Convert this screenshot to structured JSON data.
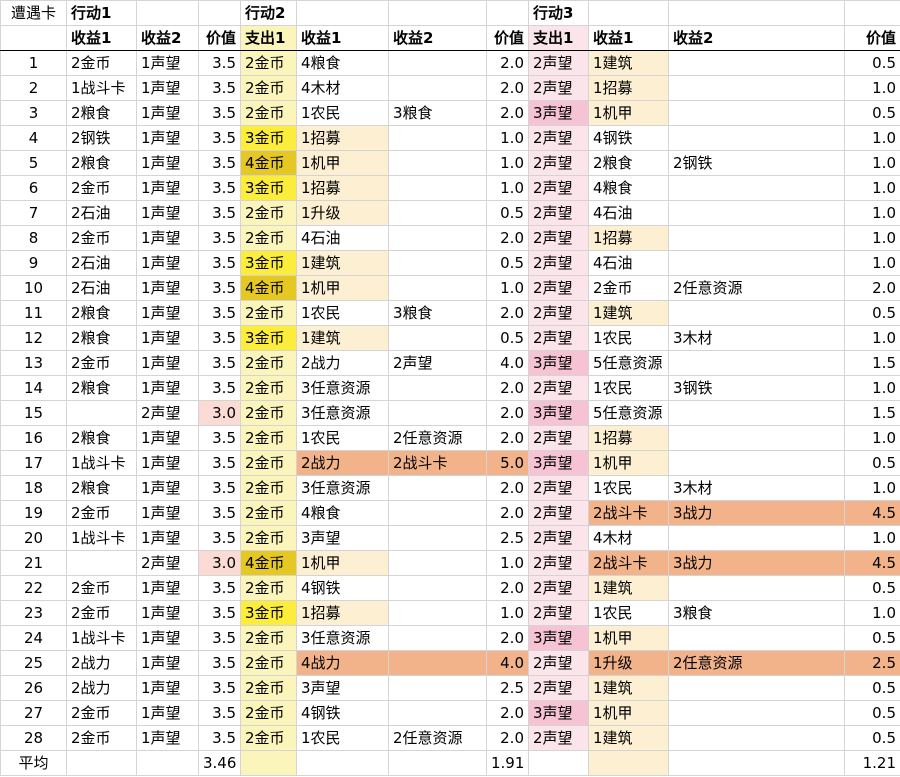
{
  "headers": {
    "row1": [
      "遭遇卡",
      "行动1",
      "",
      "",
      "行动2",
      "",
      "",
      "",
      "行动3",
      "",
      "",
      ""
    ],
    "row2": [
      "",
      "收益1",
      "收益2",
      "价值",
      "支出1",
      "收益1",
      "收益2",
      "价值",
      "支出1",
      "收益1",
      "收益2",
      "价值"
    ]
  },
  "rows": [
    [
      "1",
      "2金币",
      "1声望",
      "3.5",
      "2金币",
      "4粮食",
      "",
      "2.0",
      "2声望",
      "1建筑",
      "",
      "0.5"
    ],
    [
      "2",
      "1战斗卡",
      "1声望",
      "3.5",
      "2金币",
      "4木材",
      "",
      "2.0",
      "2声望",
      "1招募",
      "",
      "1.0"
    ],
    [
      "3",
      "2粮食",
      "1声望",
      "3.5",
      "2金币",
      "1农民",
      "3粮食",
      "2.0",
      "3声望",
      "1机甲",
      "",
      "0.5"
    ],
    [
      "4",
      "2钢铁",
      "1声望",
      "3.5",
      "3金币",
      "1招募",
      "",
      "1.0",
      "2声望",
      "4钢铁",
      "",
      "1.0"
    ],
    [
      "5",
      "2粮食",
      "1声望",
      "3.5",
      "4金币",
      "1机甲",
      "",
      "1.0",
      "2声望",
      "2粮食",
      "2钢铁",
      "1.0"
    ],
    [
      "6",
      "2金币",
      "1声望",
      "3.5",
      "3金币",
      "1招募",
      "",
      "1.0",
      "2声望",
      "4粮食",
      "",
      "1.0"
    ],
    [
      "7",
      "2石油",
      "1声望",
      "3.5",
      "2金币",
      "1升级",
      "",
      "0.5",
      "2声望",
      "4石油",
      "",
      "1.0"
    ],
    [
      "8",
      "2金币",
      "1声望",
      "3.5",
      "2金币",
      "4石油",
      "",
      "2.0",
      "2声望",
      "1招募",
      "",
      "1.0"
    ],
    [
      "9",
      "2石油",
      "1声望",
      "3.5",
      "3金币",
      "1建筑",
      "",
      "0.5",
      "2声望",
      "4石油",
      "",
      "1.0"
    ],
    [
      "10",
      "2石油",
      "1声望",
      "3.5",
      "4金币",
      "1机甲",
      "",
      "1.0",
      "2声望",
      "2金币",
      "2任意资源",
      "2.0"
    ],
    [
      "11",
      "2粮食",
      "1声望",
      "3.5",
      "2金币",
      "1农民",
      "3粮食",
      "2.0",
      "2声望",
      "1建筑",
      "",
      "0.5"
    ],
    [
      "12",
      "2粮食",
      "1声望",
      "3.5",
      "3金币",
      "1建筑",
      "",
      "0.5",
      "2声望",
      "1农民",
      "3木材",
      "1.0"
    ],
    [
      "13",
      "2金币",
      "1声望",
      "3.5",
      "2金币",
      "2战力",
      "2声望",
      "4.0",
      "3声望",
      "5任意资源",
      "",
      "1.5"
    ],
    [
      "14",
      "2粮食",
      "1声望",
      "3.5",
      "2金币",
      "3任意资源",
      "",
      "2.0",
      "2声望",
      "1农民",
      "3钢铁",
      "1.0"
    ],
    [
      "15",
      "",
      "2声望",
      "3.0",
      "2金币",
      "3任意资源",
      "",
      "2.0",
      "3声望",
      "5任意资源",
      "",
      "1.5"
    ],
    [
      "16",
      "2粮食",
      "1声望",
      "3.5",
      "2金币",
      "1农民",
      "2任意资源",
      "2.0",
      "2声望",
      "1招募",
      "",
      "1.0"
    ],
    [
      "17",
      "1战斗卡",
      "1声望",
      "3.5",
      "2金币",
      "2战力",
      "2战斗卡",
      "5.0",
      "3声望",
      "1机甲",
      "",
      "0.5"
    ],
    [
      "18",
      "2粮食",
      "1声望",
      "3.5",
      "2金币",
      "3任意资源",
      "",
      "2.0",
      "2声望",
      "1农民",
      "3木材",
      "1.0"
    ],
    [
      "19",
      "2金币",
      "1声望",
      "3.5",
      "2金币",
      "4粮食",
      "",
      "2.0",
      "2声望",
      "2战斗卡",
      "3战力",
      "4.5"
    ],
    [
      "20",
      "1战斗卡",
      "1声望",
      "3.5",
      "2金币",
      "3声望",
      "",
      "2.5",
      "2声望",
      "4木材",
      "",
      "1.0"
    ],
    [
      "21",
      "",
      "2声望",
      "3.0",
      "4金币",
      "1机甲",
      "",
      "1.0",
      "2声望",
      "2战斗卡",
      "3战力",
      "4.5"
    ],
    [
      "22",
      "2金币",
      "1声望",
      "3.5",
      "2金币",
      "4钢铁",
      "",
      "2.0",
      "2声望",
      "1建筑",
      "",
      "0.5"
    ],
    [
      "23",
      "2金币",
      "1声望",
      "3.5",
      "3金币",
      "1招募",
      "",
      "1.0",
      "2声望",
      "1农民",
      "3粮食",
      "1.0"
    ],
    [
      "24",
      "1战斗卡",
      "1声望",
      "3.5",
      "2金币",
      "3任意资源",
      "",
      "2.0",
      "3声望",
      "1机甲",
      "",
      "0.5"
    ],
    [
      "25",
      "2战力",
      "1声望",
      "3.5",
      "2金币",
      "4战力",
      "",
      "4.0",
      "2声望",
      "1升级",
      "2任意资源",
      "2.5"
    ],
    [
      "26",
      "2战力",
      "1声望",
      "3.5",
      "2金币",
      "3声望",
      "",
      "2.5",
      "2声望",
      "1建筑",
      "",
      "0.5"
    ],
    [
      "27",
      "2金币",
      "1声望",
      "3.5",
      "2金币",
      "4钢铁",
      "",
      "2.0",
      "3声望",
      "1机甲",
      "",
      "0.5"
    ],
    [
      "28",
      "2金币",
      "1声望",
      "3.5",
      "2金币",
      "1农民",
      "2任意资源",
      "2.0",
      "2声望",
      "1建筑",
      "",
      "0.5"
    ]
  ],
  "average": [
    "平均",
    "",
    "",
    "3.46",
    "",
    "",
    "",
    "1.91",
    "",
    "",
    "",
    "1.21"
  ],
  "colors": {
    "light_yellow": "#fbf5bb",
    "light_pink": "#fbe5ea",
    "cream": "#fdf0d2",
    "yellow": "#fcec3c",
    "dark_yellow": "#e6c825",
    "pink": "#f5c3d3",
    "orange": "#f2b38b",
    "salmon": "#fbdcd4"
  }
}
